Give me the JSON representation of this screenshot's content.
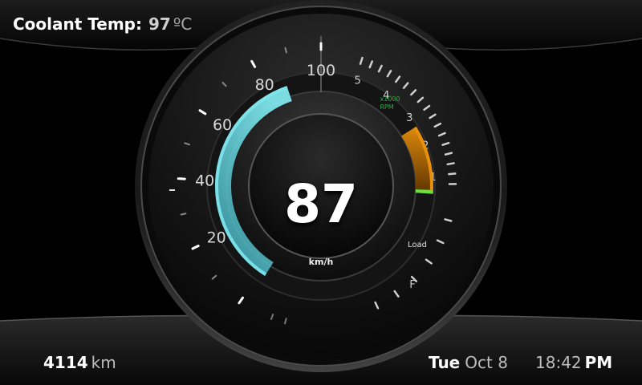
{
  "coolant": {
    "label": "Coolant Temp:",
    "value": "97",
    "unit": "ºC"
  },
  "odometer": {
    "value": "4114",
    "unit": "km"
  },
  "date": {
    "day": "Tue",
    "month_day": "Oct 8"
  },
  "clock": {
    "time": "18:42",
    "ampm": "PM"
  },
  "speed": {
    "value": "87",
    "unit": "km/h",
    "max": 100
  },
  "speed_scale": [
    "20",
    "40",
    "60",
    "80",
    "100"
  ],
  "rpm": {
    "multiplier": "x1000",
    "unit": "RPM",
    "scale": [
      "1",
      "2",
      "3",
      "4",
      "5"
    ],
    "level": 0.19
  },
  "fuel": {
    "full_label": "F",
    "load_label": "Load"
  },
  "colors": {
    "speed_arc": "#7fe6ec",
    "rpm_arc": "#e8900c",
    "load_indicator": "#6be03c",
    "rpm_label": "#2ea84a"
  }
}
